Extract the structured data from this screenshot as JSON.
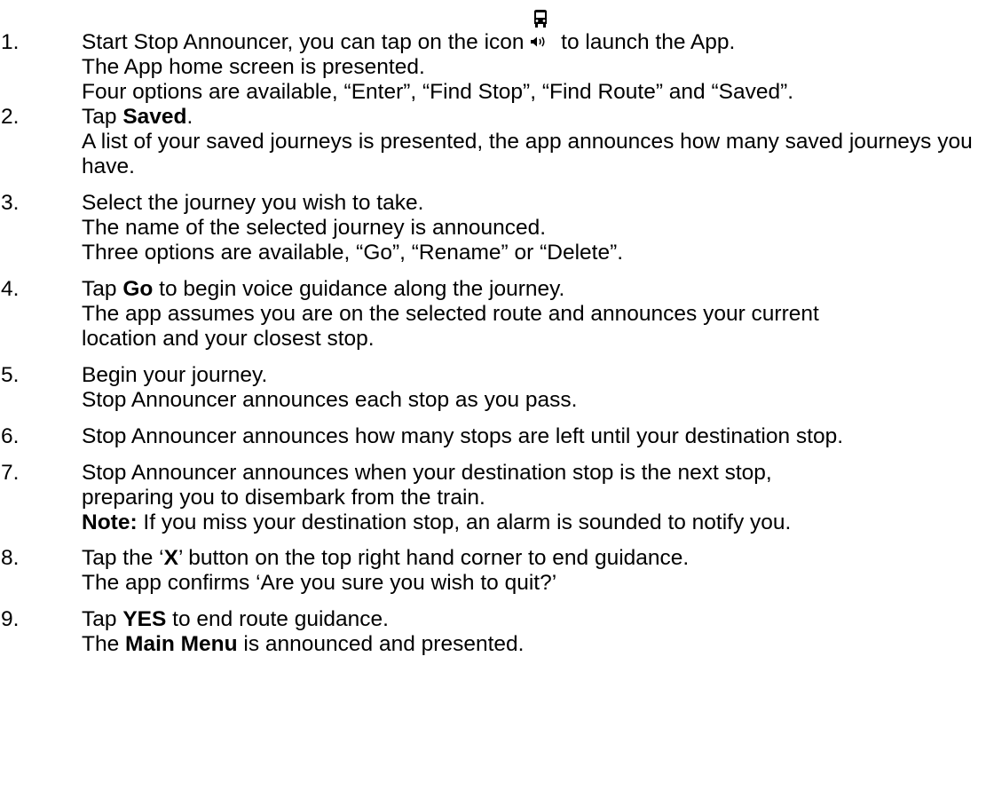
{
  "steps": [
    {
      "num": "1.",
      "l1_pre": "Start Stop Announcer, you can tap on the icon",
      "l1_post": " to launch the App.",
      "l2": "The App home screen is presented.",
      "l3": "Four options are available, “Enter”, “Find Stop”, “Find Route” and “Saved”."
    },
    {
      "num": "2.",
      "l1_pre": "Tap ",
      "l1_bold": "Saved",
      "l1_post": ".",
      "l2": "A list of your saved journeys is presented, the app announces how many saved journeys you have."
    },
    {
      "num": "3.",
      "l1": "Select the journey you wish to take.",
      "l2": "The name of the selected journey is announced.",
      "l3": "Three options are available, “Go”, “Rename” or “Delete”."
    },
    {
      "num": "4.",
      "l1_pre": "Tap ",
      "l1_bold": "Go",
      "l1_post": " to begin voice guidance along the journey.",
      "l2": "The app assumes you are on the selected route and announces your current location and your closest stop."
    },
    {
      "num": "5.",
      "l1": "Begin your journey.",
      "l2": "Stop Announcer announces each stop as you pass."
    },
    {
      "num": "6.",
      "l1": "Stop Announcer announces how many stops are left until your destination stop."
    },
    {
      "num": "7.",
      "l1": "Stop Announcer announces when your destination stop is the next stop, preparing you to disembark from the train.",
      "note_label": "Note:",
      "note_text": " If you miss your destination stop, an alarm is sounded to notify you."
    },
    {
      "num": "8.",
      "l1_pre": "Tap the ‘",
      "l1_bold": "X",
      "l1_post": "’ button on the top right hand corner to end guidance.",
      "l2": "The app confirms ‘Are you sure you wish to quit?’"
    },
    {
      "num": "9.",
      "l1_pre": "Tap ",
      "l1_bold": "YES",
      "l1_post": " to end route guidance.",
      "l2_pre": "The ",
      "l2_bold": "Main Menu",
      "l2_post": " is announced and presented."
    }
  ],
  "icons": {
    "app_icon": "bus-speaker-icon"
  }
}
